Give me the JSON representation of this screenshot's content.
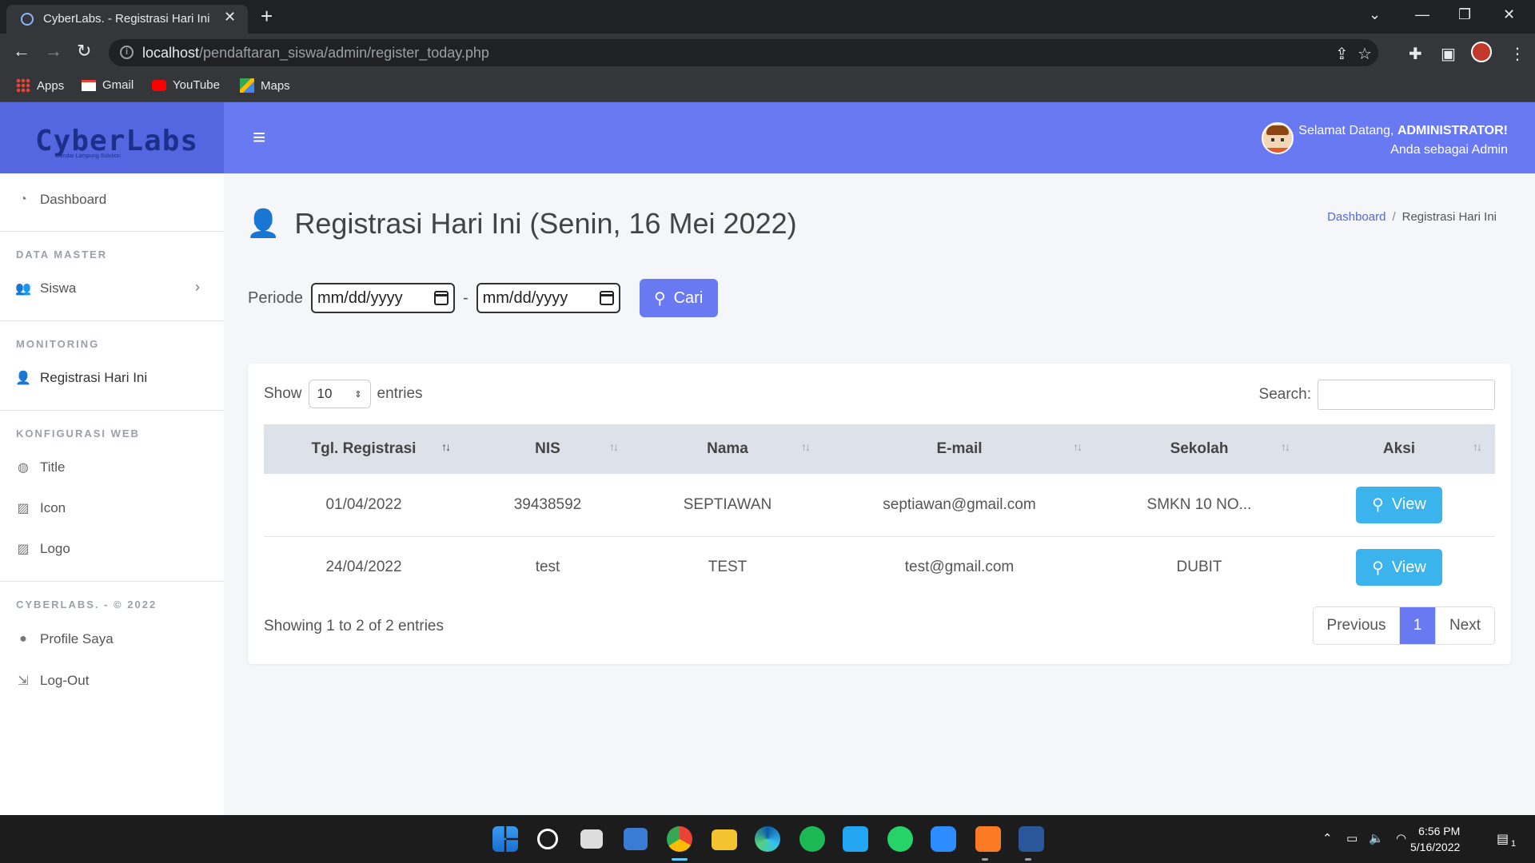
{
  "browser": {
    "tab_title": "CyberLabs. - Registrasi Hari Ini",
    "url_host": "localhost",
    "url_path": "/pendaftaran_siswa/admin/register_today.php",
    "bookmarks": [
      {
        "label": "Apps",
        "icon": "apps-grid-icon"
      },
      {
        "label": "Gmail",
        "icon": "gmail-icon"
      },
      {
        "label": "YouTube",
        "icon": "youtube-icon"
      },
      {
        "label": "Maps",
        "icon": "maps-icon"
      }
    ]
  },
  "brand": {
    "logo_text": "CyberLabs",
    "logo_subtext": "Bandar Lampung Solution"
  },
  "header": {
    "welcome_prefix": "Selamat Datang,",
    "welcome_user": "ADMINISTRATOR!",
    "role_text": "Anda sebagai Admin"
  },
  "sidebar": {
    "dashboard": "Dashboard",
    "section_master": "DATA MASTER",
    "siswa": "Siswa",
    "section_monitoring": "MONITORING",
    "registrasi": "Registrasi Hari Ini",
    "section_web": "KONFIGURASI WEB",
    "title": "Title",
    "icon": "Icon",
    "logo": "Logo",
    "section_footer": "CYBERLABS. - © 2022",
    "profile": "Profile Saya",
    "logout": "Log-Out"
  },
  "page": {
    "title": "Registrasi Hari Ini (Senin, 16 Mei 2022)",
    "breadcrumb_home": "Dashboard",
    "breadcrumb_current": "Registrasi Hari Ini"
  },
  "filter": {
    "label": "Periode",
    "date_from": "mm/dd/yyyy",
    "separator": "-",
    "date_to": "mm/dd/yyyy",
    "button": "Cari"
  },
  "table": {
    "show_label": "Show",
    "entries_value": "10",
    "entries_label": "entries",
    "search_label": "Search:",
    "columns": [
      "Tgl. Registrasi",
      "NIS",
      "Nama",
      "E-mail",
      "Sekolah",
      "Aksi"
    ],
    "rows": [
      {
        "tgl": "01/04/2022",
        "nis": "39438592",
        "nama": "SEPTIAWAN",
        "email": "septiawan@gmail.com",
        "sekolah": "SMKN 10 NO...",
        "aksi": "View"
      },
      {
        "tgl": "24/04/2022",
        "nis": "test",
        "nama": "TEST",
        "email": "test@gmail.com",
        "sekolah": "DUBIT",
        "aksi": "View"
      }
    ],
    "info": "Showing 1 to 2 of 2 entries",
    "pager_prev": "Previous",
    "pager_current": "1",
    "pager_next": "Next"
  },
  "taskbar": {
    "time": "6:56 PM",
    "date": "5/16/2022",
    "notification_count": "1"
  },
  "colors": {
    "brand": "#5567e0",
    "topnav": "#6979f2",
    "view_button": "#3bb3ec"
  }
}
